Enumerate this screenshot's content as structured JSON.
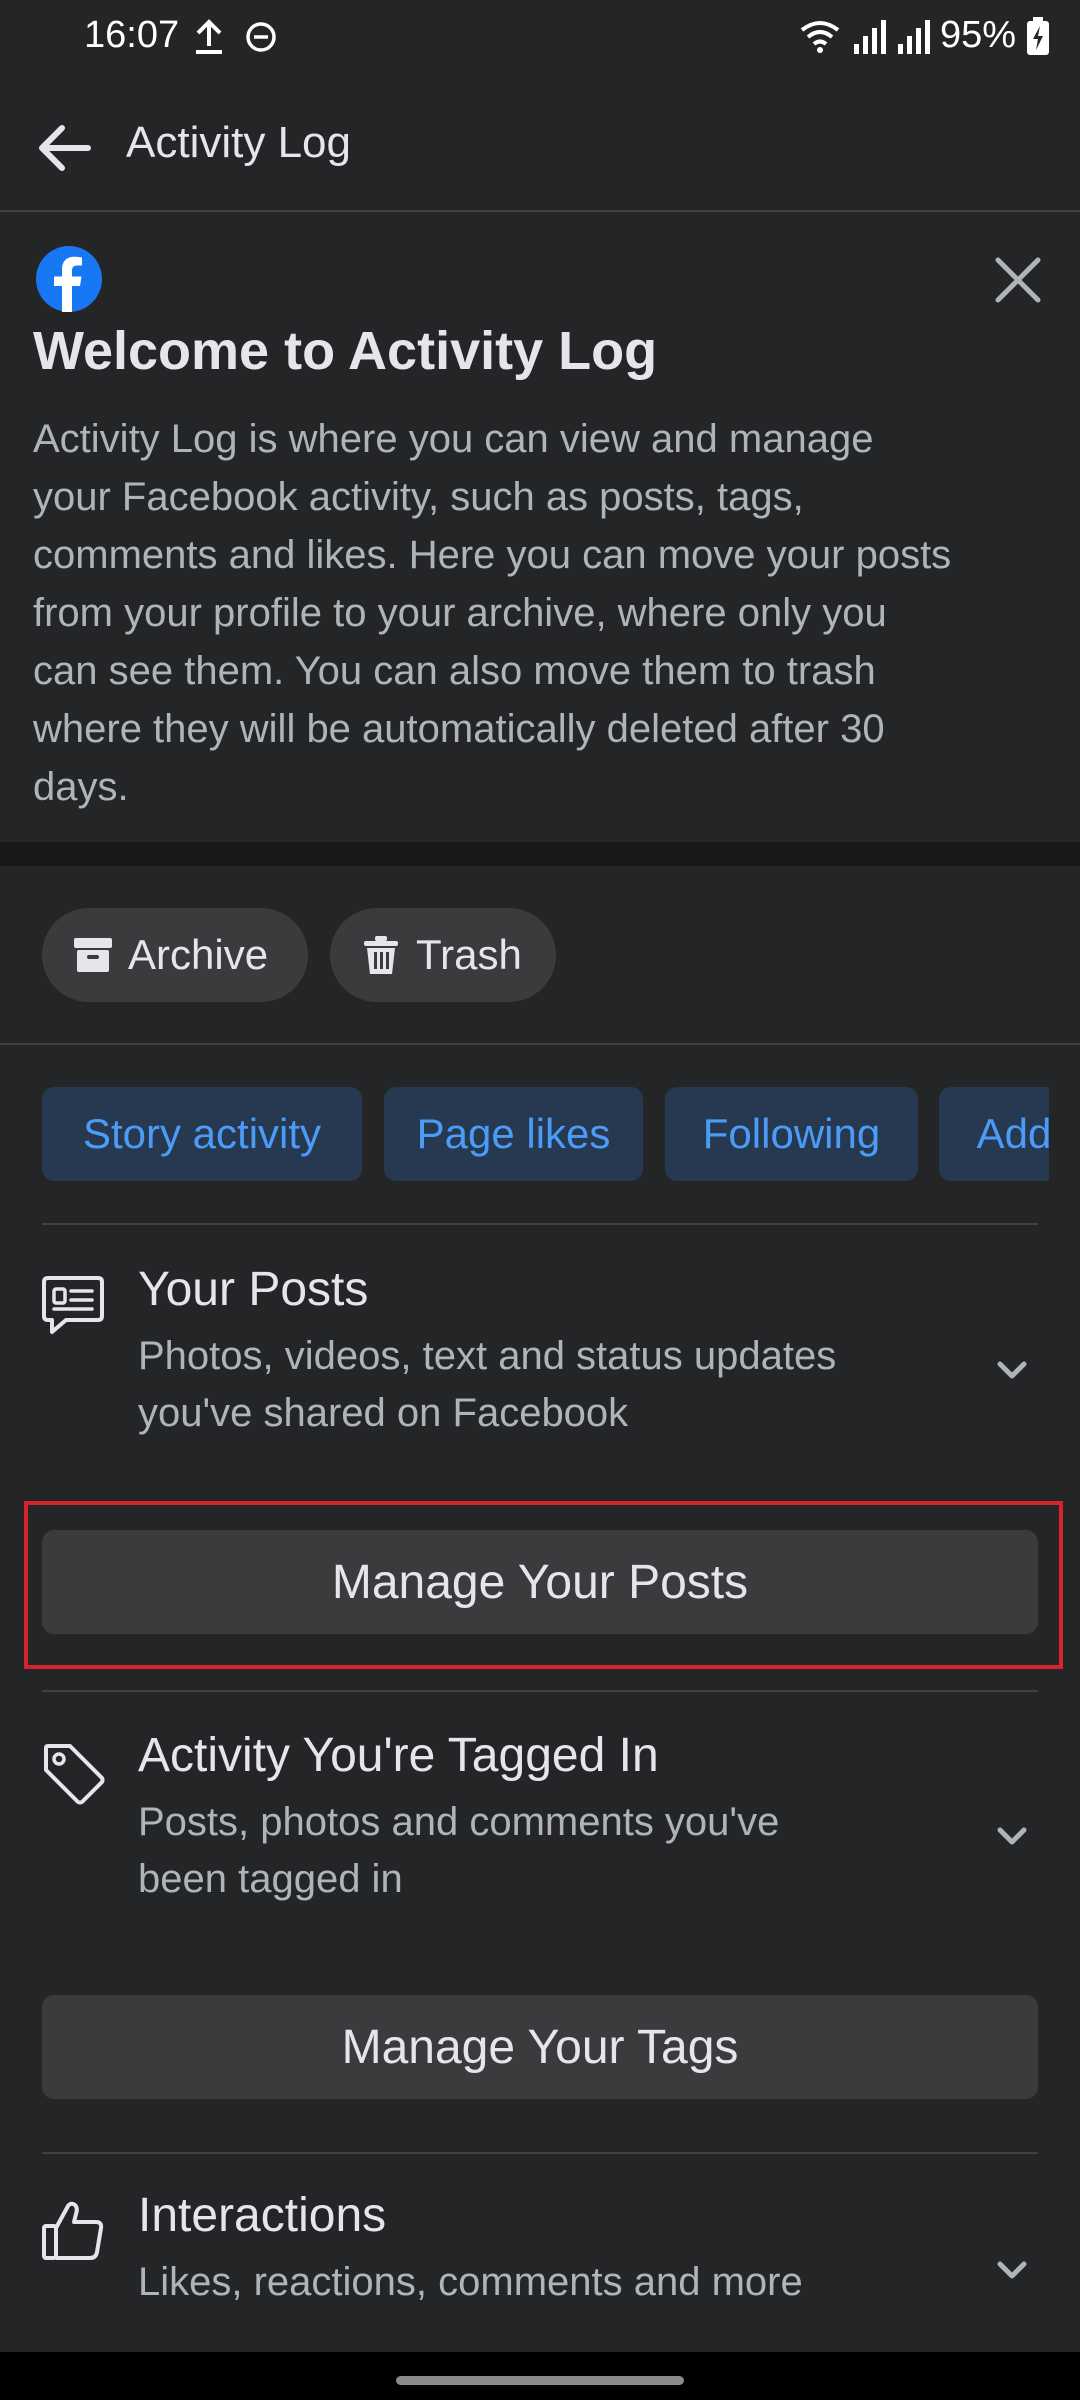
{
  "status_bar": {
    "time": "16:07",
    "battery": "95%"
  },
  "app_bar": {
    "title": "Activity Log"
  },
  "welcome": {
    "title": "Welcome to Activity Log",
    "body_lines": [
      "Activity Log is where you can view and manage",
      "your Facebook activity, such as posts, tags,",
      "comments and likes. Here you can move your posts",
      "from your profile to your archive, where only you",
      "can see them. You can also move them to trash",
      "where they will be automatically deleted after 30",
      "days."
    ]
  },
  "chips": {
    "archive": "Archive",
    "trash": "Trash"
  },
  "tabs": [
    "Story activity",
    "Page likes",
    "Following",
    "Add"
  ],
  "sections": {
    "posts": {
      "title": "Your Posts",
      "desc_lines": [
        "Photos, videos, text and status updates",
        "you've shared on Facebook"
      ],
      "button": "Manage Your Posts"
    },
    "tagged": {
      "title": "Activity You're Tagged In",
      "desc_lines": [
        "Posts, photos and comments you've",
        "been tagged in"
      ],
      "button": "Manage Your Tags"
    },
    "interactions": {
      "title": "Interactions",
      "desc_lines": [
        "Likes, reactions, comments and more"
      ]
    }
  },
  "colors": {
    "highlight": "#d6232d",
    "accent": "#4b9cf7",
    "facebook": "#1877f2"
  }
}
